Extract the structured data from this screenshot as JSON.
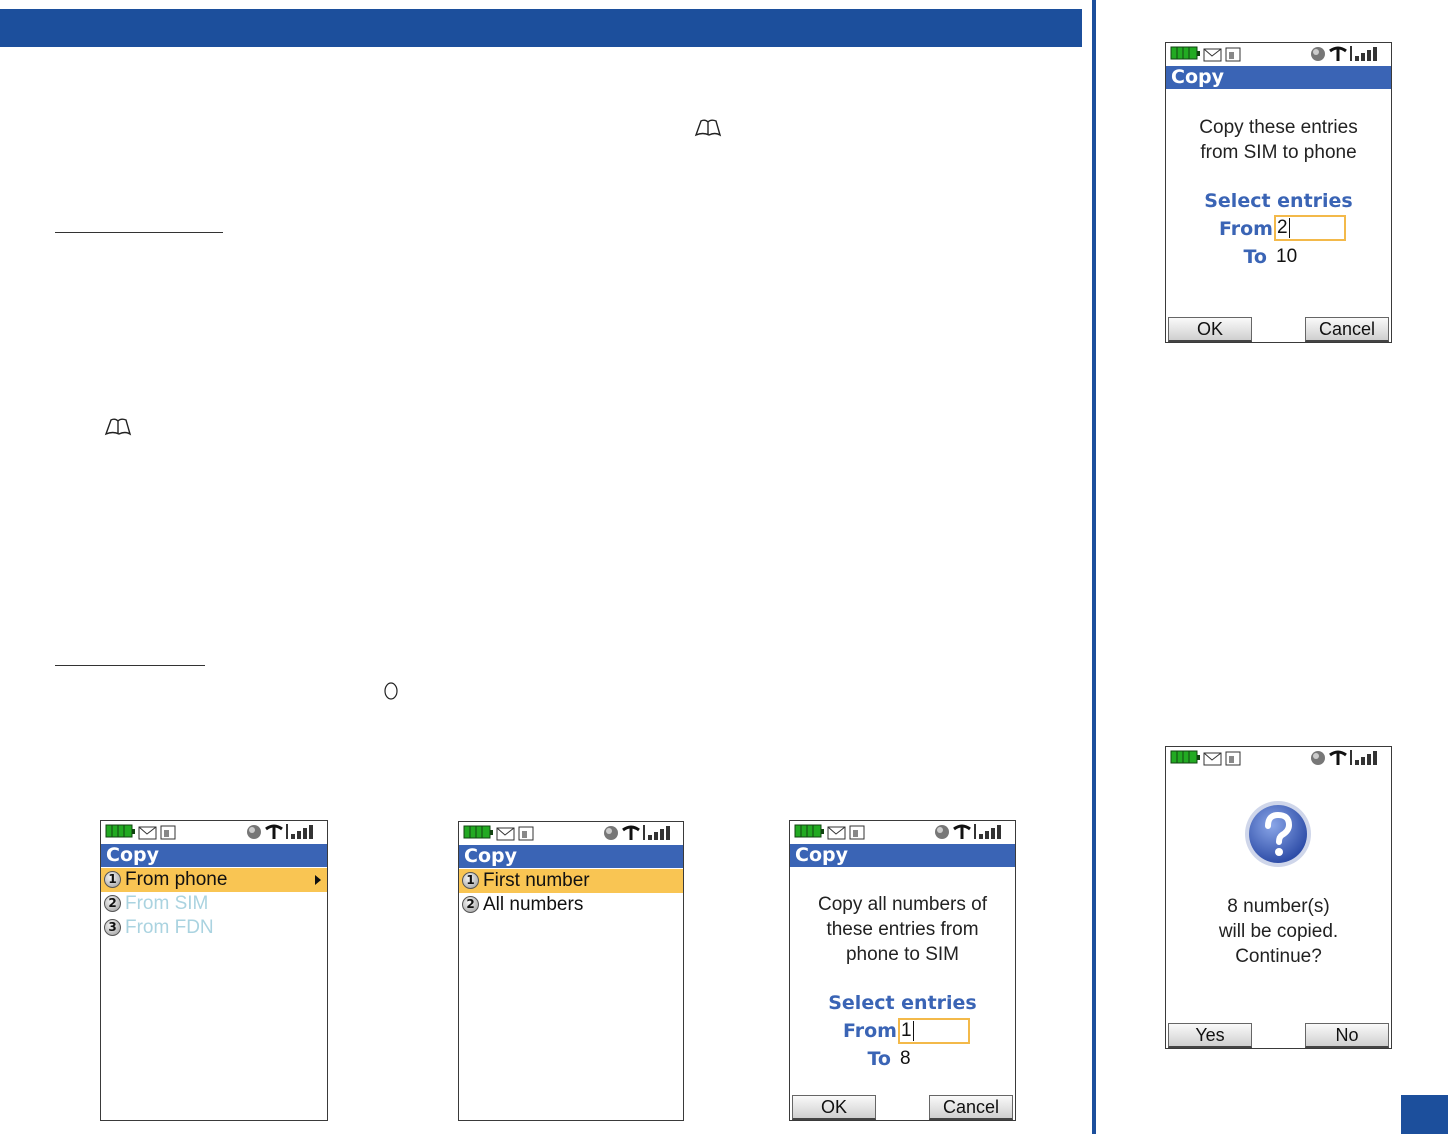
{
  "icons": {
    "battery": "battery-icon",
    "message": "message-icon",
    "sim": "sim-icon",
    "globe": "globe-icon",
    "antenna": "antenna-icon",
    "signal": "signal-icon",
    "book": "book-icon",
    "key": "circle-key-icon",
    "question": "question-icon"
  },
  "colors": {
    "brand": "#1c4f9c",
    "titlebar": "#3a64b5",
    "highlight": "#f9c553",
    "input_border": "#f3b94a"
  },
  "screen_copy_menu": {
    "title": "Copy",
    "items": [
      {
        "num": "1",
        "label": "From phone",
        "state": "selected"
      },
      {
        "num": "2",
        "label": "From SIM",
        "state": "disabled"
      },
      {
        "num": "3",
        "label": "From FDN",
        "state": "disabled"
      }
    ]
  },
  "screen_number_choice": {
    "title": "Copy",
    "items": [
      {
        "num": "1",
        "label": "First number",
        "state": "selected"
      },
      {
        "num": "2",
        "label": "All numbers",
        "state": "normal"
      }
    ]
  },
  "screen_phone_to_sim": {
    "title": "Copy",
    "message": [
      "Copy all numbers of",
      "these entries from",
      "phone to SIM"
    ],
    "select_label": "Select entries",
    "from_label": "From",
    "from_value": "1",
    "to_label": "To",
    "to_value": "8",
    "ok": "OK",
    "cancel": "Cancel"
  },
  "screen_sim_to_phone": {
    "title": "Copy",
    "message": [
      "Copy these entries",
      "from SIM to phone"
    ],
    "select_label": "Select entries",
    "from_label": "From",
    "from_value": "2",
    "to_label": "To",
    "to_value": "10",
    "ok": "OK",
    "cancel": "Cancel"
  },
  "screen_confirm": {
    "message": [
      "8 number(s)",
      "will be copied.",
      "Continue?"
    ],
    "yes": "Yes",
    "no": "No"
  }
}
